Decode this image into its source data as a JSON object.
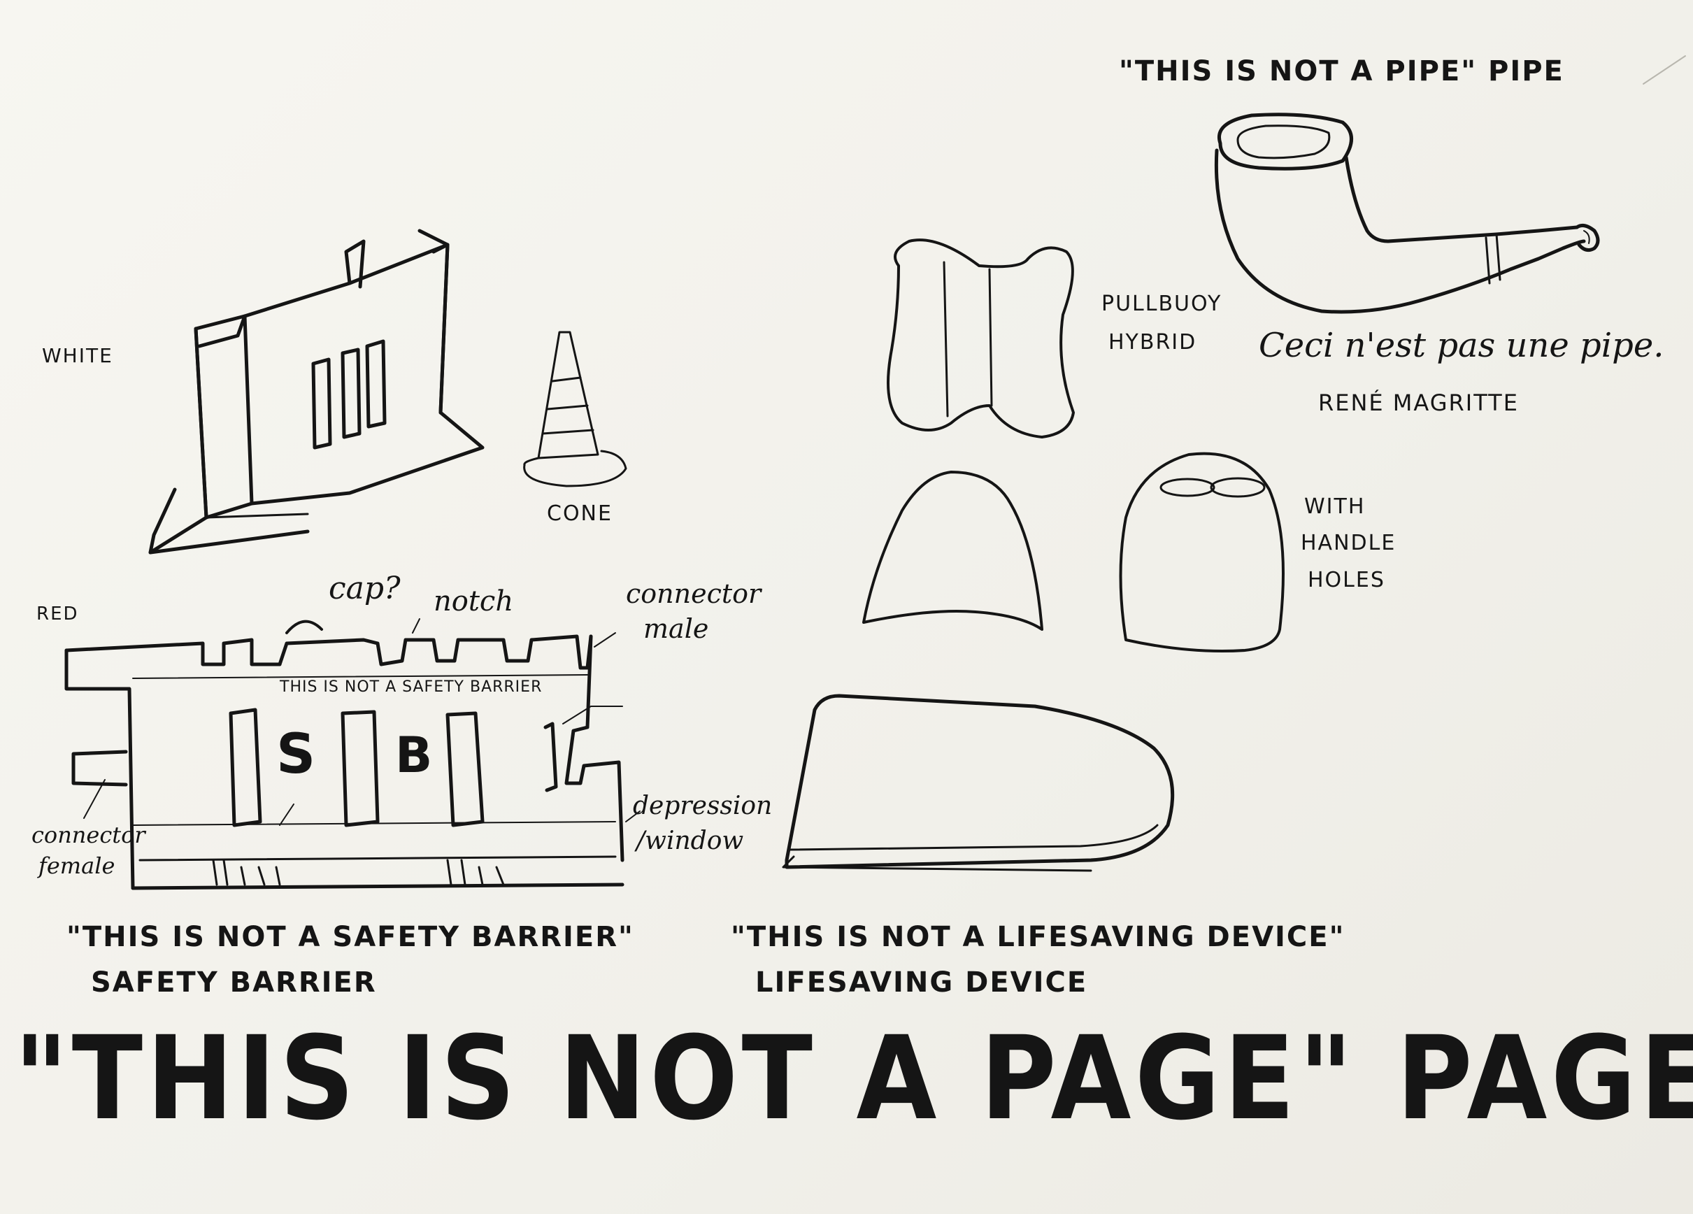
{
  "colors": {
    "paper": "#f3f2ec",
    "ink": "#151515"
  },
  "labels": {
    "pipe_title": "\"THIS IS NOT A PIPE\" PIPE",
    "pipe_caption": "Ceci n'est pas une pipe.",
    "pipe_artist": "RENÉ MAGRITTE",
    "pullbuoy": [
      "PULLBUOY",
      "HYBRID"
    ],
    "handle_holes": [
      "WITH",
      "HANDLE",
      "HOLES"
    ],
    "white": "WHITE",
    "cone": "CONE",
    "red": "RED",
    "cap": "cap?",
    "notch": "notch",
    "connector_male": [
      "connector",
      "male"
    ],
    "connector_female": [
      "connector",
      "female"
    ],
    "depression_window": [
      "depression",
      "/window"
    ],
    "barrier_inscription": "THIS IS NOT A SAFETY BARRIER",
    "barrier_letter_s": "S",
    "barrier_letter_b": "B",
    "barrier_quote": "\"THIS IS NOT A SAFETY BARRIER\"",
    "barrier_name": "SAFETY BARRIER",
    "lifesaving_quote": "\"THIS IS NOT A LIFESAVING DEVICE\"",
    "lifesaving_name": "LIFESAVING DEVICE",
    "page_title": "\"THIS IS NOT A PAGE\" PAGE"
  }
}
